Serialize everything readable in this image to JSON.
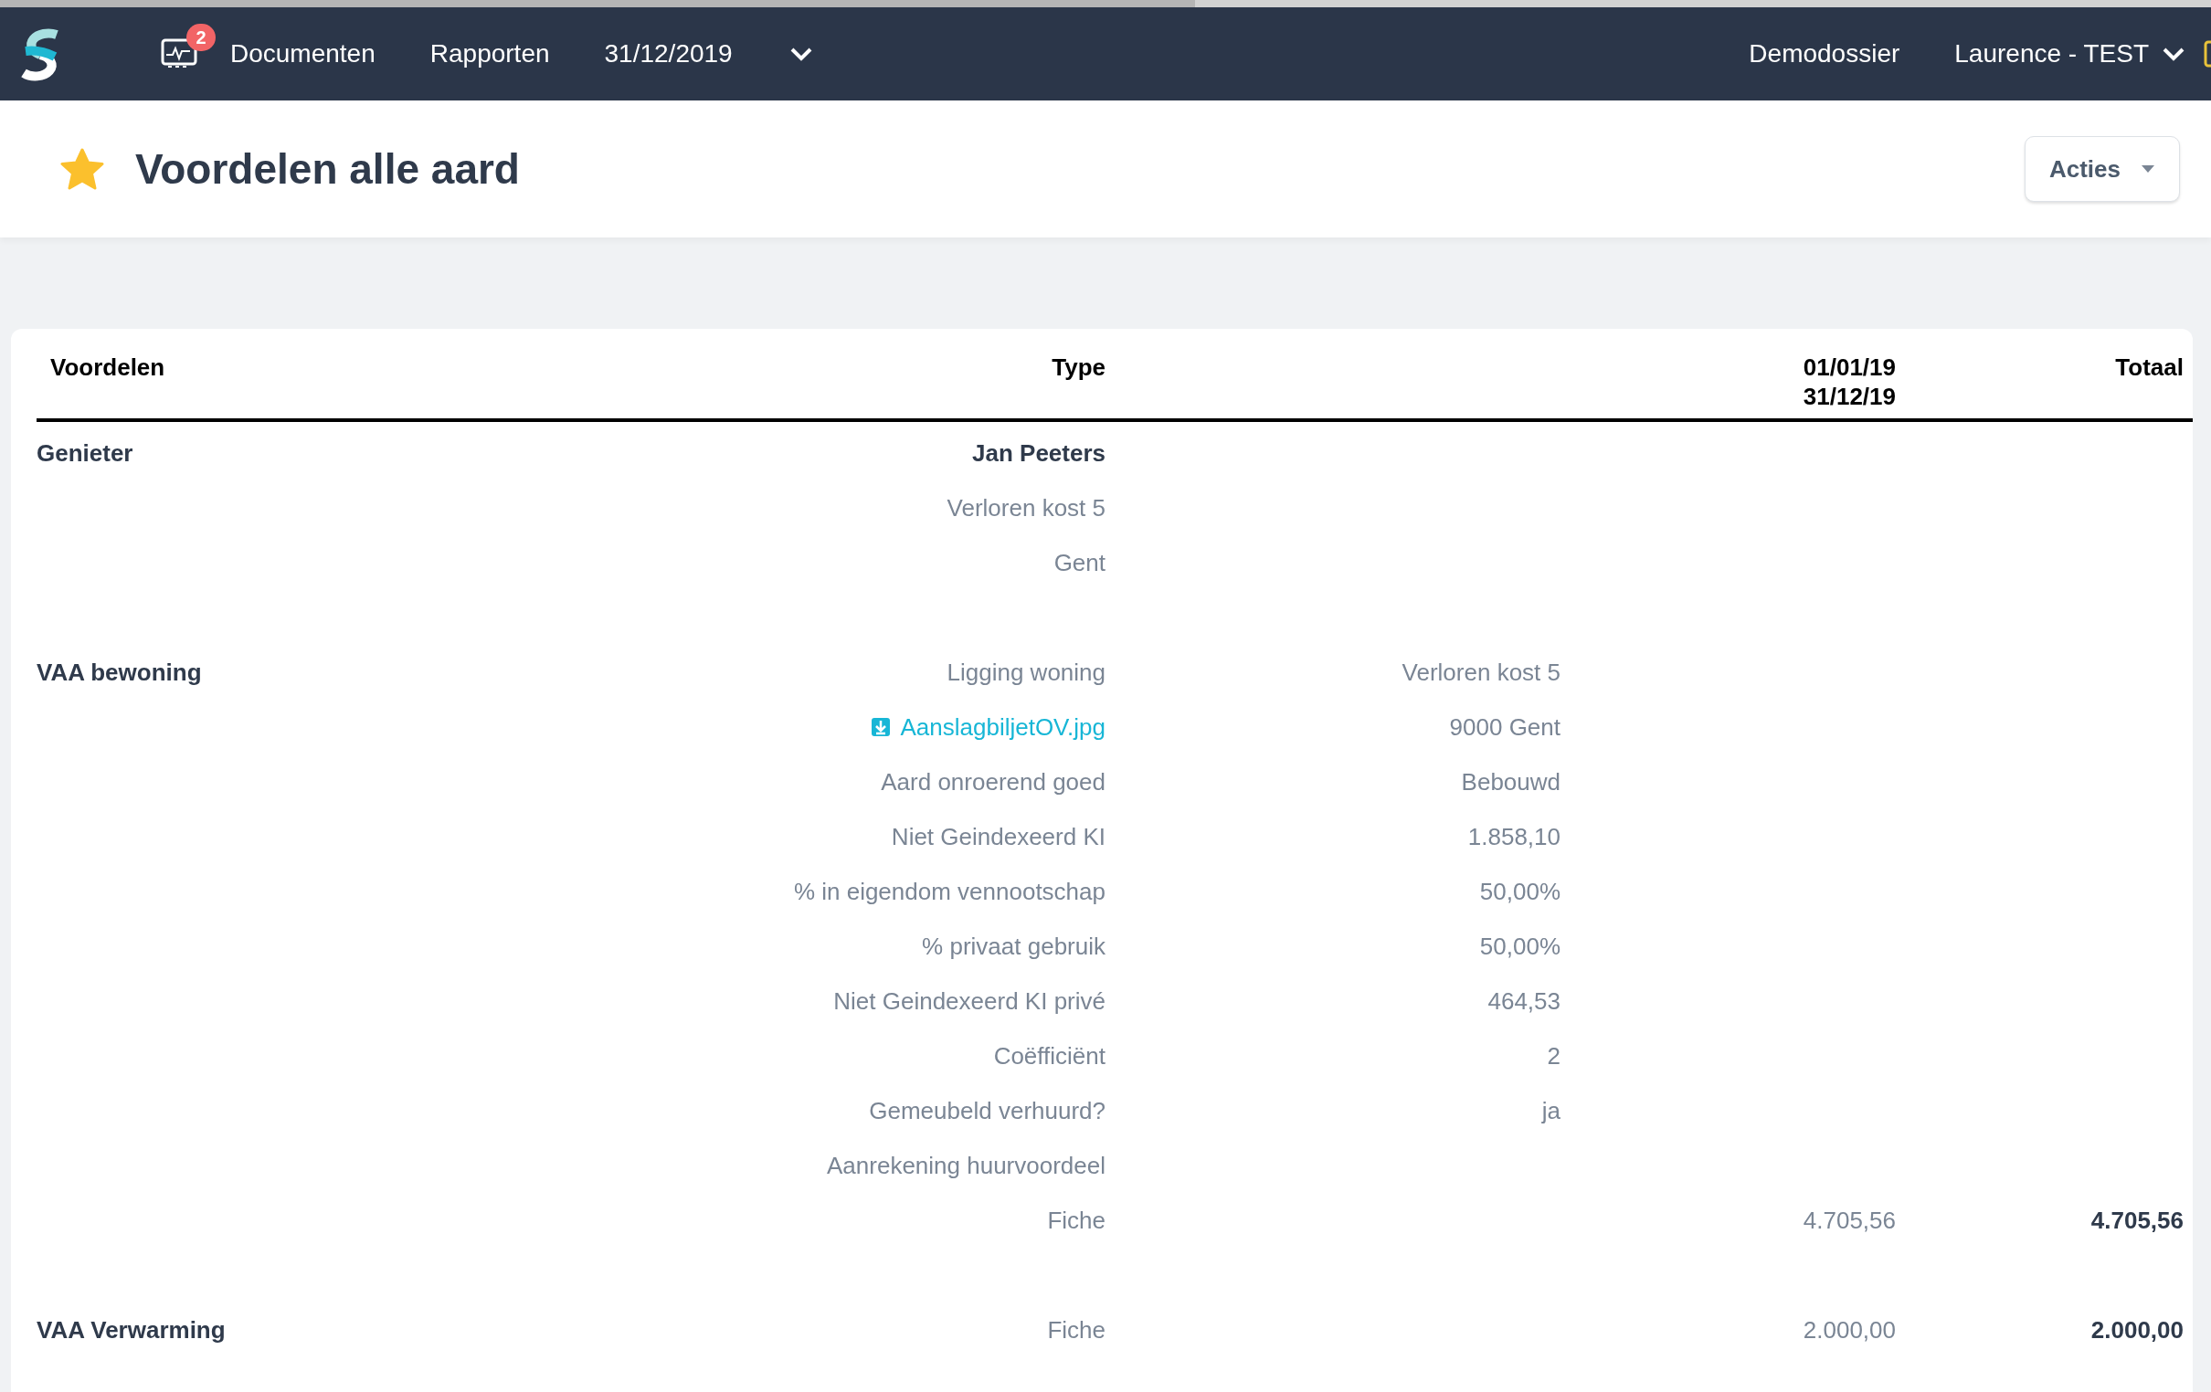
{
  "nav": {
    "notifications": "2",
    "links": [
      {
        "label": "Documenten"
      },
      {
        "label": "Rapporten"
      }
    ],
    "period": "31/12/2019",
    "dossier": "Demodossier",
    "user": "Laurence - TEST"
  },
  "page": {
    "title": "Voordelen alle aard",
    "favorite": true,
    "actions": "Acties"
  },
  "table": {
    "columns": [
      {
        "label": "Voordelen"
      },
      {
        "label": "Type"
      },
      {
        "label": "01/01/19\n31/12/19"
      },
      {
        "label": "Totaal"
      }
    ],
    "groups": [
      {
        "label": "Genieter",
        "rows": [
          {
            "kind": "bold",
            "type": "Jan Peeters"
          },
          {
            "kind": "text",
            "type": "Verloren kost 5"
          },
          {
            "kind": "text",
            "type": "Gent"
          }
        ]
      },
      {
        "label": "VAA bewoning",
        "rows": [
          {
            "kind": "text",
            "type": "Ligging woning",
            "value": "Verloren kost 5"
          },
          {
            "kind": "link",
            "type": "AanslagbiljetOV.jpg",
            "value": "9000 Gent"
          },
          {
            "kind": "text",
            "type": "Aard onroerend goed",
            "value": "Bebouwd"
          },
          {
            "kind": "text",
            "type": "Niet Geindexeerd KI",
            "value": "1.858,10"
          },
          {
            "kind": "text",
            "type": "% in eigendom vennootschap",
            "value": "50,00%"
          },
          {
            "kind": "text",
            "type": "% privaat gebruik",
            "value": "50,00%"
          },
          {
            "kind": "text",
            "type": "Niet Geindexeerd KI privé",
            "value": "464,53"
          },
          {
            "kind": "text",
            "type": "Coëfficiënt",
            "value": "2"
          },
          {
            "kind": "text",
            "type": "Gemeubeld verhuurd?",
            "value": "ja"
          },
          {
            "kind": "text",
            "type": "Aanrekening huurvoordeel"
          },
          {
            "kind": "text",
            "type": "Fiche",
            "period": "4.705,56",
            "total": "4.705,56"
          }
        ]
      },
      {
        "label": "VAA Verwarming",
        "rows": [
          {
            "kind": "text",
            "type": "Fiche",
            "period": "2.000,00",
            "total": "2.000,00"
          }
        ]
      }
    ]
  }
}
